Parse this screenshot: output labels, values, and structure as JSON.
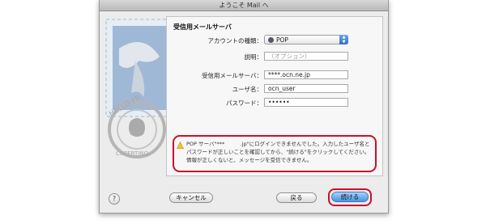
{
  "window": {
    "title": "ようこそ Mail へ"
  },
  "panel": {
    "section_title": "受信用メールサーバ",
    "account_type": {
      "label": "アカウントの種類：",
      "value": "POP"
    },
    "description": {
      "label": "説明：",
      "placeholder": "（オプション）"
    },
    "incoming_server": {
      "label": "受信用メールサーバ：",
      "value": "****.ocn.ne.jp"
    },
    "username": {
      "label": "ユーザ名：",
      "value": "ocn_user"
    },
    "password": {
      "label": "パスワード：",
      "value": "••••••"
    }
  },
  "error": {
    "message": "POP サーバ\"***　　　.jp\"にログインできませんでした。入力したユーザ名とパスワードが正しいことを確認してから、\"続ける\"をクリックしてください。情報が正しくないと、メッセージを受信できません。"
  },
  "buttons": {
    "help": "?",
    "cancel": "キャンセル",
    "back": "戻る",
    "continue": "続ける"
  },
  "stamp": {
    "text": "HELLO FR",
    "city": "CUPERTINO"
  },
  "colors": {
    "highlight": "#c8102e",
    "primary_button": "#4a93e6"
  }
}
